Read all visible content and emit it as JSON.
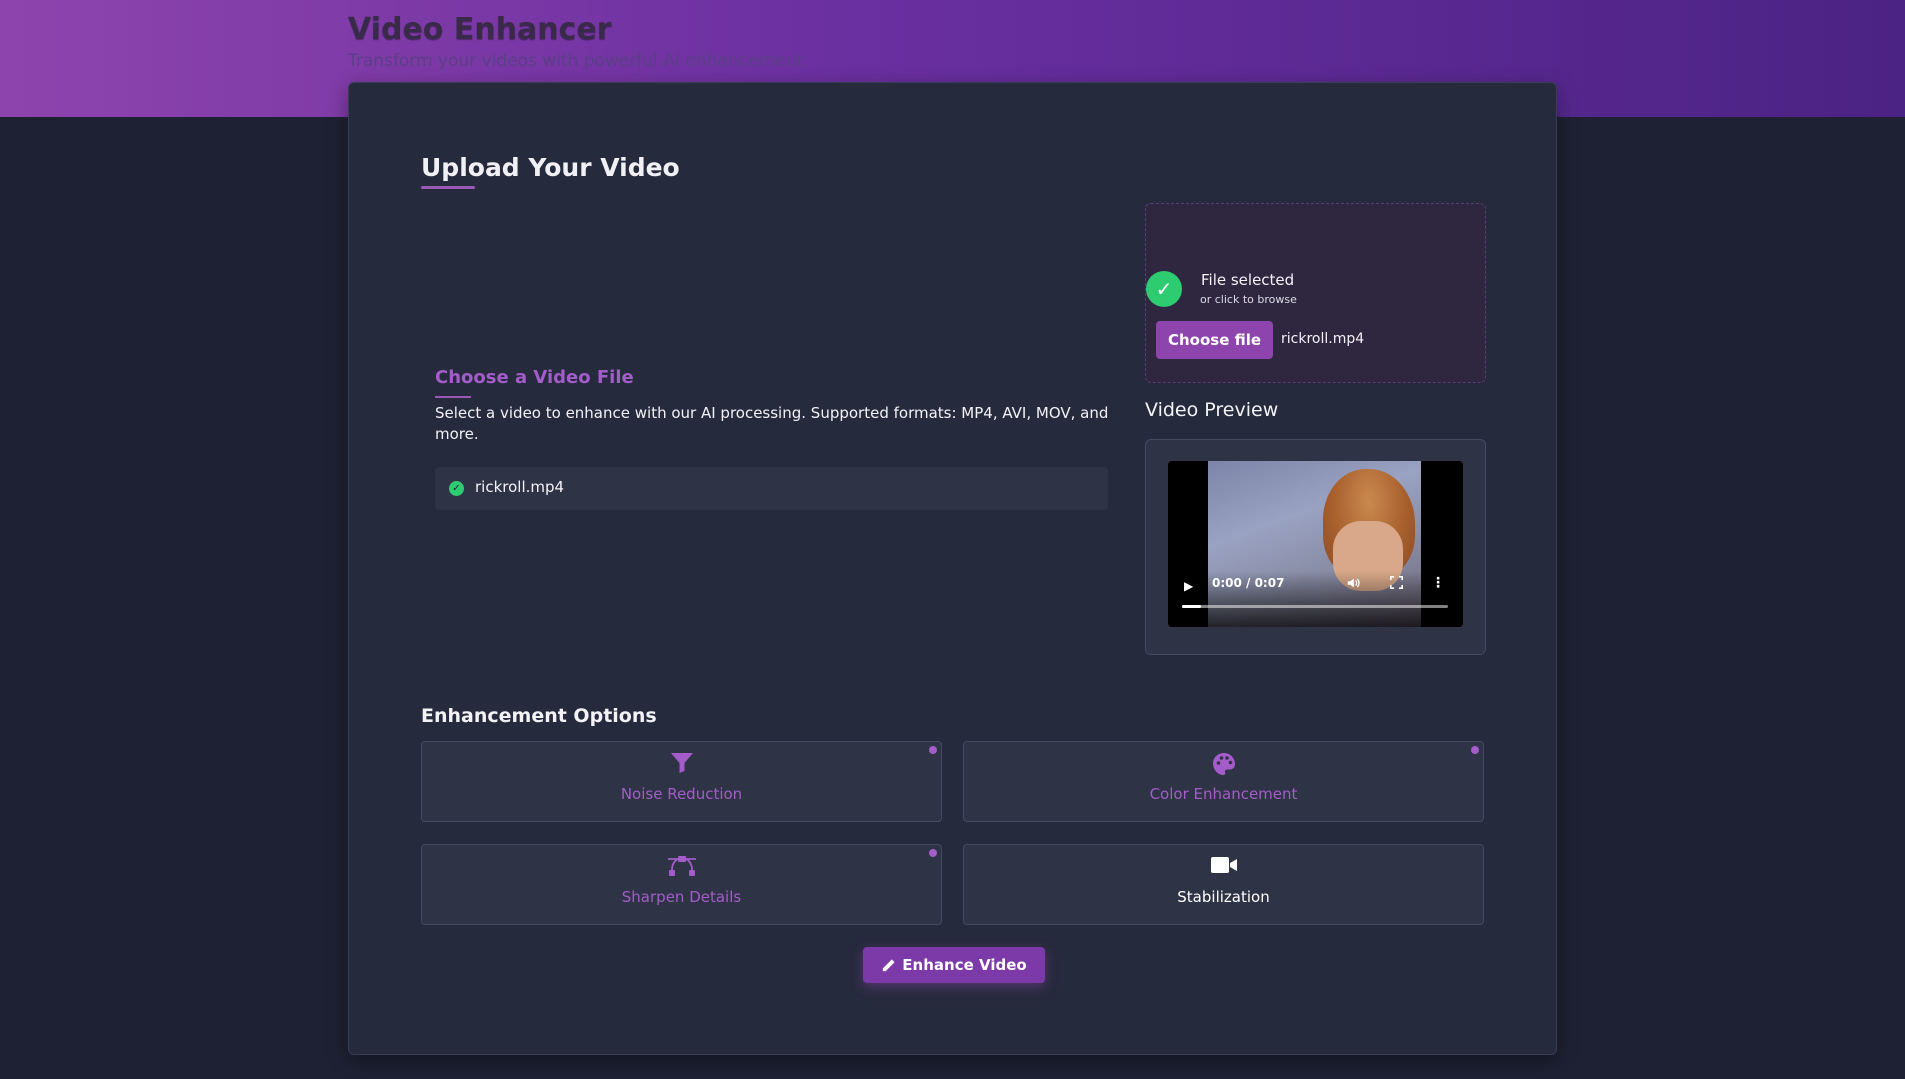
{
  "header": {
    "title": "Video Enhancer",
    "subtitle": "Transform your videos with powerful AI enhancement"
  },
  "upload": {
    "heading": "Upload Your Video",
    "choose_heading": "Choose a Video File",
    "description": "Select a video to enhance with our AI processing. Supported formats: MP4, AVI, MOV, and more.",
    "selected_file": "rickroll.mp4",
    "drop_zone": {
      "status": "File selected",
      "hint": "or click to browse",
      "button_label": "Choose file",
      "filename": "rickroll.mp4"
    }
  },
  "preview": {
    "heading": "Video Preview",
    "time": "0:00 / 0:07",
    "progress": 0.07,
    "icons": [
      "play-icon",
      "volume-icon",
      "fullscreen-icon",
      "more-options-icon"
    ]
  },
  "options": {
    "heading": "Enhancement Options",
    "items": [
      {
        "label": "Noise Reduction",
        "icon": "filter-icon",
        "active": true
      },
      {
        "label": "Color Enhancement",
        "icon": "palette-icon",
        "active": true
      },
      {
        "label": "Sharpen Details",
        "icon": "bezier-curve-icon",
        "active": true
      },
      {
        "label": "Stabilization",
        "icon": "video-camera-icon",
        "active": false
      }
    ]
  },
  "actions": {
    "enhance_label": "Enhance Video"
  },
  "colors": {
    "accent": "#8e44ad",
    "accent_text": "#a35cc9",
    "success": "#2ecc71",
    "background": "#1e2133",
    "card": "#262a3d"
  }
}
